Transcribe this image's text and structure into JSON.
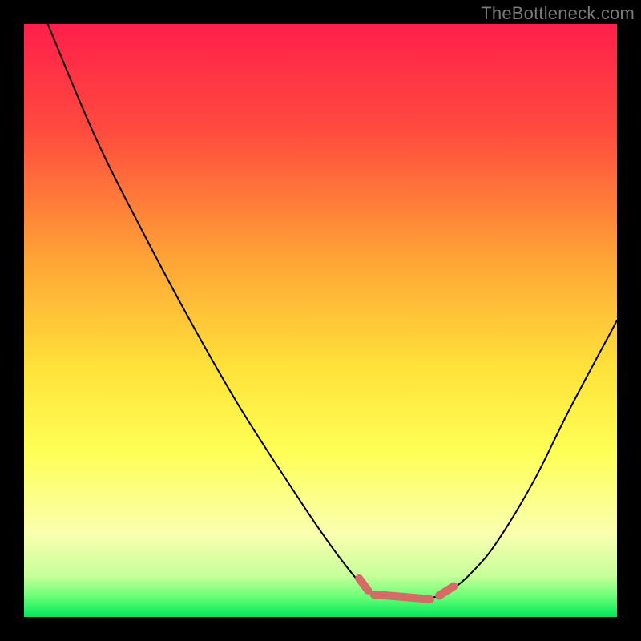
{
  "watermark": "TheBottleneck.com",
  "chart_data": {
    "type": "line",
    "title": "",
    "xlabel": "",
    "ylabel": "",
    "xlim": [
      0,
      100
    ],
    "ylim": [
      0,
      100
    ],
    "gradient_stops": [
      {
        "offset": 0,
        "color": "#ff1f4b"
      },
      {
        "offset": 0.18,
        "color": "#ff4b3e"
      },
      {
        "offset": 0.4,
        "color": "#ffa536"
      },
      {
        "offset": 0.58,
        "color": "#ffe23a"
      },
      {
        "offset": 0.72,
        "color": "#feff55"
      },
      {
        "offset": 0.86,
        "color": "#faffb0"
      },
      {
        "offset": 0.93,
        "color": "#c8ff9a"
      },
      {
        "offset": 0.965,
        "color": "#6cff78"
      },
      {
        "offset": 1.0,
        "color": "#00e85a"
      }
    ],
    "series": [
      {
        "name": "bottleneck-curve",
        "stroke": "#000000",
        "stroke_width": 2.0,
        "points": [
          {
            "x": 4.0,
            "y": 100.0
          },
          {
            "x": 12.0,
            "y": 81.0
          },
          {
            "x": 20.0,
            "y": 65.0
          },
          {
            "x": 28.0,
            "y": 50.0
          },
          {
            "x": 36.0,
            "y": 36.0
          },
          {
            "x": 44.0,
            "y": 23.5
          },
          {
            "x": 50.0,
            "y": 14.5
          },
          {
            "x": 54.0,
            "y": 9.0
          },
          {
            "x": 57.0,
            "y": 5.5
          },
          {
            "x": 60.0,
            "y": 3.5
          },
          {
            "x": 63.0,
            "y": 3.0
          },
          {
            "x": 66.0,
            "y": 3.0
          },
          {
            "x": 69.0,
            "y": 3.3
          },
          {
            "x": 72.0,
            "y": 4.5
          },
          {
            "x": 76.0,
            "y": 8.0
          },
          {
            "x": 80.0,
            "y": 13.0
          },
          {
            "x": 86.0,
            "y": 23.0
          },
          {
            "x": 92.0,
            "y": 35.0
          },
          {
            "x": 100.0,
            "y": 50.0
          }
        ]
      },
      {
        "name": "min-highlight",
        "stroke": "#d66a66",
        "stroke_width": 10.0,
        "segments": [
          [
            {
              "x": 56.5,
              "y": 6.5
            },
            {
              "x": 58.0,
              "y": 4.5
            }
          ],
          [
            {
              "x": 59.0,
              "y": 3.8
            },
            {
              "x": 68.5,
              "y": 3.0
            }
          ],
          [
            {
              "x": 70.0,
              "y": 3.6
            },
            {
              "x": 72.5,
              "y": 5.2
            }
          ]
        ]
      }
    ]
  }
}
